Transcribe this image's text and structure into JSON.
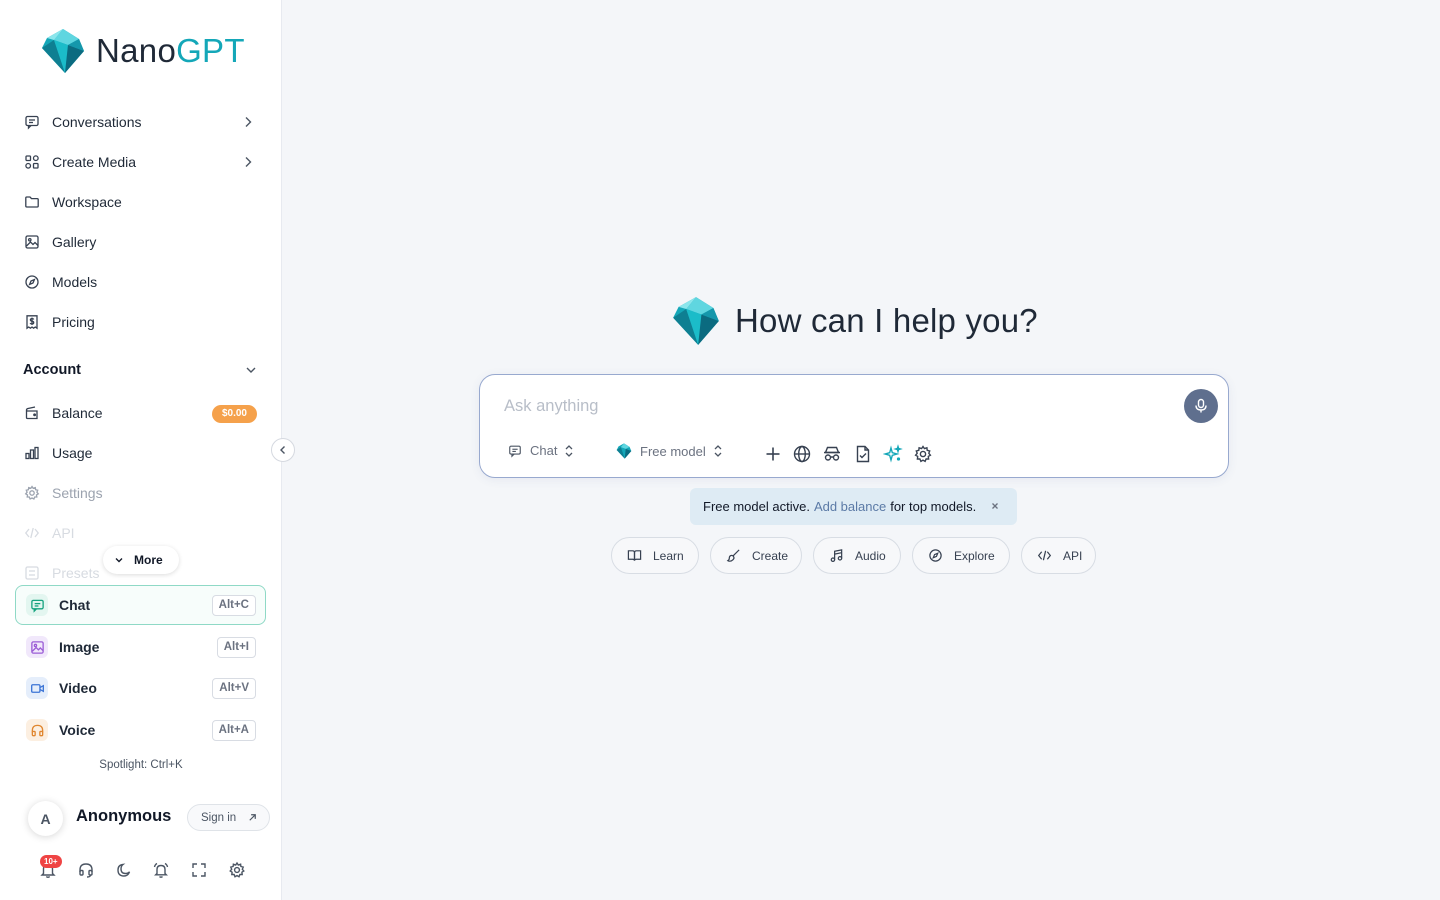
{
  "brand": {
    "name_prefix": "Nano",
    "name_suffix": "GPT"
  },
  "nav": {
    "conversations": "Conversations",
    "create_media": "Create Media",
    "workspace": "Workspace",
    "gallery": "Gallery",
    "models": "Models",
    "pricing": "Pricing"
  },
  "account": {
    "title": "Account",
    "balance": "Balance",
    "balance_value": "$0.00",
    "usage": "Usage",
    "settings": "Settings",
    "api": "API",
    "presets": "Presets",
    "more": "More"
  },
  "modes": [
    {
      "label": "Chat",
      "shortcut": "Alt+C"
    },
    {
      "label": "Image",
      "shortcut": "Alt+I"
    },
    {
      "label": "Video",
      "shortcut": "Alt+V"
    },
    {
      "label": "Voice",
      "shortcut": "Alt+A"
    }
  ],
  "spotlight": "Spotlight: Ctrl+K",
  "user": {
    "avatar_letter": "A",
    "name": "Anonymous",
    "sign_in": "Sign in"
  },
  "notifications": {
    "count": "10+"
  },
  "main": {
    "title": "How can I help you?",
    "placeholder": "Ask anything",
    "mode_selector": "Chat",
    "model_selector": "Free model",
    "notice_prefix": "Free model active.",
    "notice_link": "Add balance",
    "notice_suffix": "for top models.",
    "chips": [
      "Learn",
      "Create",
      "Audio",
      "Explore",
      "API"
    ]
  },
  "colors": {
    "accent": "#14a7b8",
    "balance_badge": "#f5a14b",
    "mic": "#5f6f8e",
    "notice_bg": "#deebf4",
    "active_border": "#8fd9c6"
  }
}
